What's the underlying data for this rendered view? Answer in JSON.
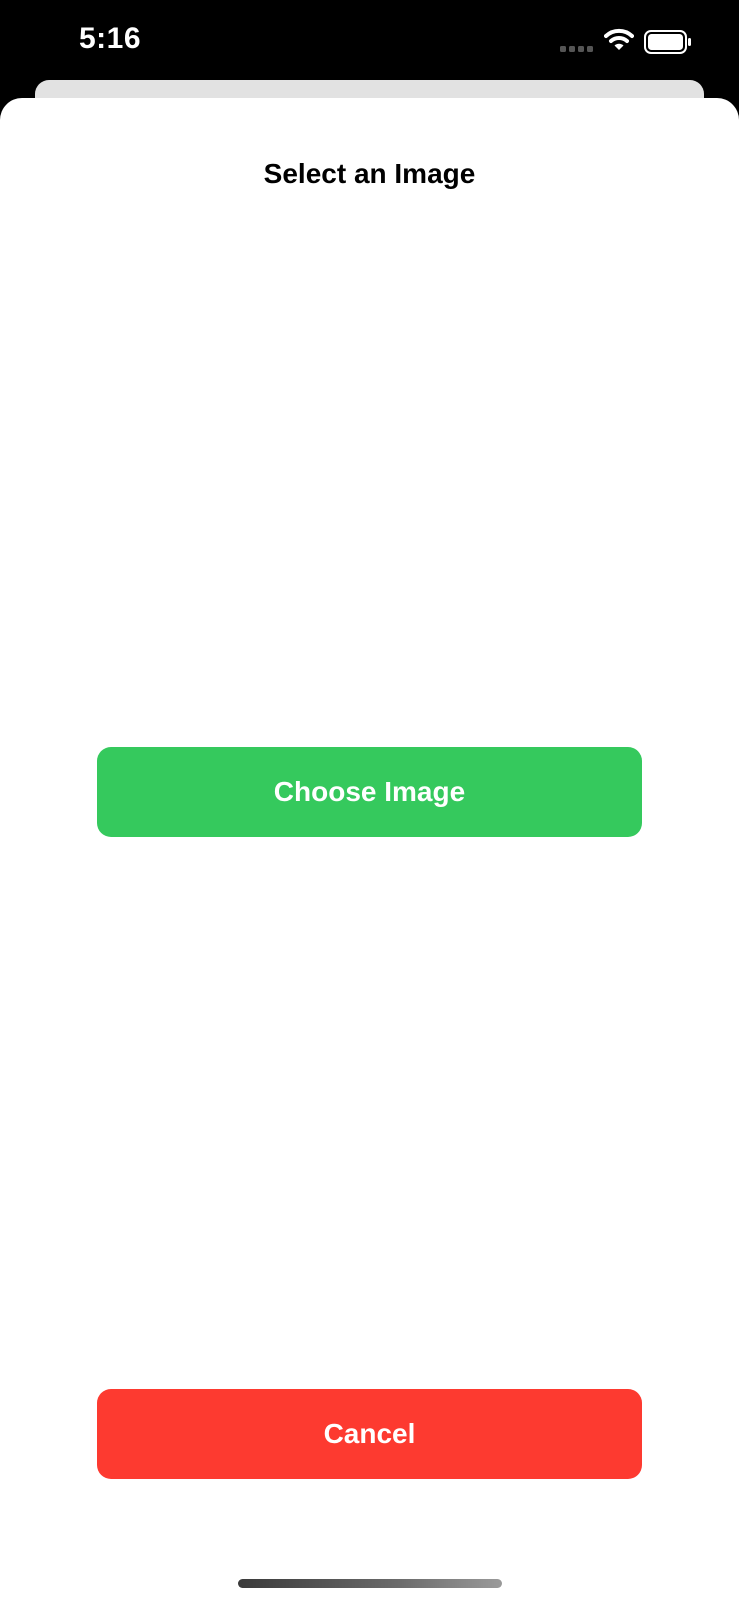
{
  "status_bar": {
    "time": "5:16",
    "icons": [
      "cellular-signal-icon",
      "wifi-icon",
      "battery-icon"
    ]
  },
  "sheet": {
    "title": "Select an Image",
    "choose_button_label": "Choose Image",
    "cancel_button_label": "Cancel"
  },
  "colors": {
    "choose_button": "#35c95d",
    "cancel_button": "#fd3a30",
    "sheet_background": "#ffffff",
    "status_bar_background": "#000000"
  }
}
